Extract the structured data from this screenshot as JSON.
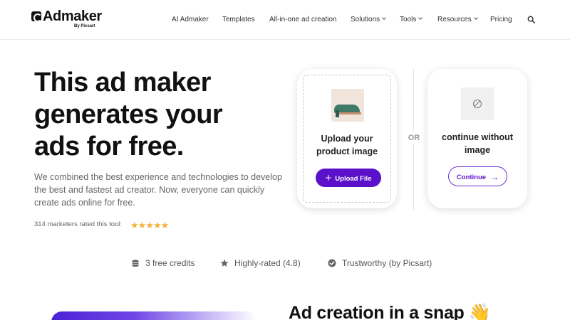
{
  "brand": {
    "name": "Admaker",
    "sub": "By Picsart"
  },
  "nav": {
    "items": [
      {
        "label": "AI Admaker",
        "dropdown": false
      },
      {
        "label": "Templates",
        "dropdown": false
      },
      {
        "label": "All-in-one ad creation",
        "dropdown": false
      },
      {
        "label": "Solutions",
        "dropdown": true
      },
      {
        "label": "Tools",
        "dropdown": true
      },
      {
        "label": "Resources",
        "dropdown": true
      },
      {
        "label": "Pricing",
        "dropdown": false
      }
    ],
    "search_icon": "search-icon"
  },
  "hero": {
    "title_line1": "This ad maker",
    "title_line2": "generates your",
    "title_line3": "ads for free.",
    "description": "We combined the best experience and technologies to develop the best and fastest ad creator. Now, everyone can quickly create ads online for free.",
    "rating_text": "314 marketers rated this tool:",
    "stars": 5,
    "star_color": "#f3b33d"
  },
  "upload_card": {
    "label_line1": "Upload your",
    "label_line2": "product image",
    "button_label": "Upload File",
    "button_color": "#5b10c9"
  },
  "divider": {
    "or_text": "OR"
  },
  "continue_card": {
    "label_line1": "continue without",
    "label_line2": "image",
    "button_label": "Continue",
    "icon": "no-image-icon"
  },
  "features": [
    {
      "label": "3 free credits",
      "icon": "coins-icon"
    },
    {
      "label": "Highly-rated (4.8)",
      "icon": "star-icon"
    },
    {
      "label": "Trustworthy (by Picsart)",
      "icon": "check-circle-icon"
    }
  ],
  "section": {
    "title": "Ad creation in a snap",
    "emoji": "👋"
  },
  "accent_color": "#5b10c9"
}
